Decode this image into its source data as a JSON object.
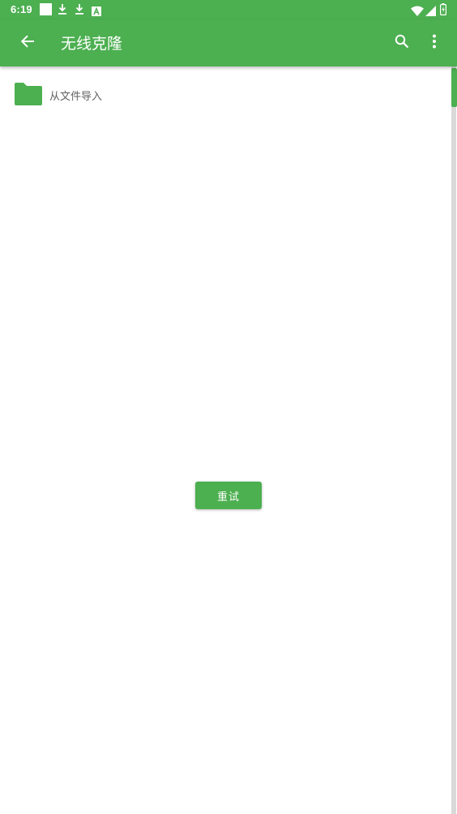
{
  "status_bar": {
    "time": "6:19",
    "icons_left": [
      "square-notification-icon",
      "download-icon",
      "download-icon",
      "a-notification-icon"
    ],
    "icons_right": [
      "wifi-icon",
      "cellular-signal-icon",
      "battery-icon"
    ]
  },
  "app_bar": {
    "title": "无线克隆",
    "back_icon": "arrow-back-icon",
    "actions": [
      "search-icon",
      "more-vert-icon"
    ]
  },
  "content": {
    "import_item": {
      "icon": "folder-icon",
      "label": "从文件导入"
    },
    "retry_button": {
      "label": "重试"
    }
  },
  "colors": {
    "primary": "#4caf50",
    "on_primary": "#ffffff",
    "text_secondary": "#616161",
    "background": "#ffffff",
    "scroll_track": "#d9d9d9"
  }
}
